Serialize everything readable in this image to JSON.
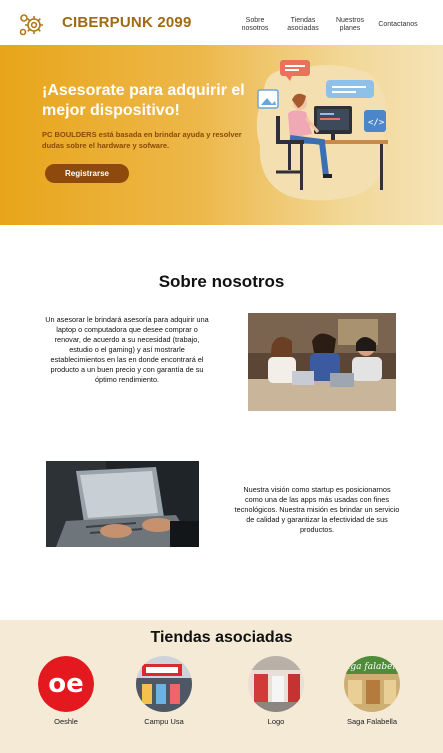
{
  "nav": {
    "brand": "CIBERPUNK 2099",
    "links": [
      "Sobre nosotros",
      "Tiendas asociadas",
      "Nuestros planes",
      "Contactanos"
    ]
  },
  "hero": {
    "title": "¡Asesorate para adquirir el mejor dispositivo!",
    "subtitle": "PC BOULDERS está basada en brindar ayuda y resolver dudas sobre el hardware y sofware.",
    "cta_label": "Registrarse"
  },
  "about": {
    "title": "Sobre nosotros",
    "paragraph1": "Un asesorar le brindará asesoría para adquirir una laptop o computadora que desee comprar o renovar, de acuerdo a su necesidad (trabajo, estudio o el gaming) y así mostrarle establecimientos en las en donde encontrará el producto a un buen precio y con garantía de su óptimo rendimiento.",
    "paragraph2": "Nuestra visión como startup es posicionarnos como una de las apps más usadas con fines tecnológicos. Nuestra misión es brindar un servicio de calidad y garantizar la efectividad de sus productos."
  },
  "stores": {
    "title": "Tiendas asociadas",
    "items": [
      {
        "label": "Oeshle"
      },
      {
        "label": "Campu Usa"
      },
      {
        "label": "Logo"
      },
      {
        "label": "Saga Falabella"
      }
    ]
  },
  "colors": {
    "brand": "#a06a10",
    "hero_start": "#e8a51a",
    "cta": "#8d4a0c",
    "stores_bg": "#f4ead6"
  }
}
